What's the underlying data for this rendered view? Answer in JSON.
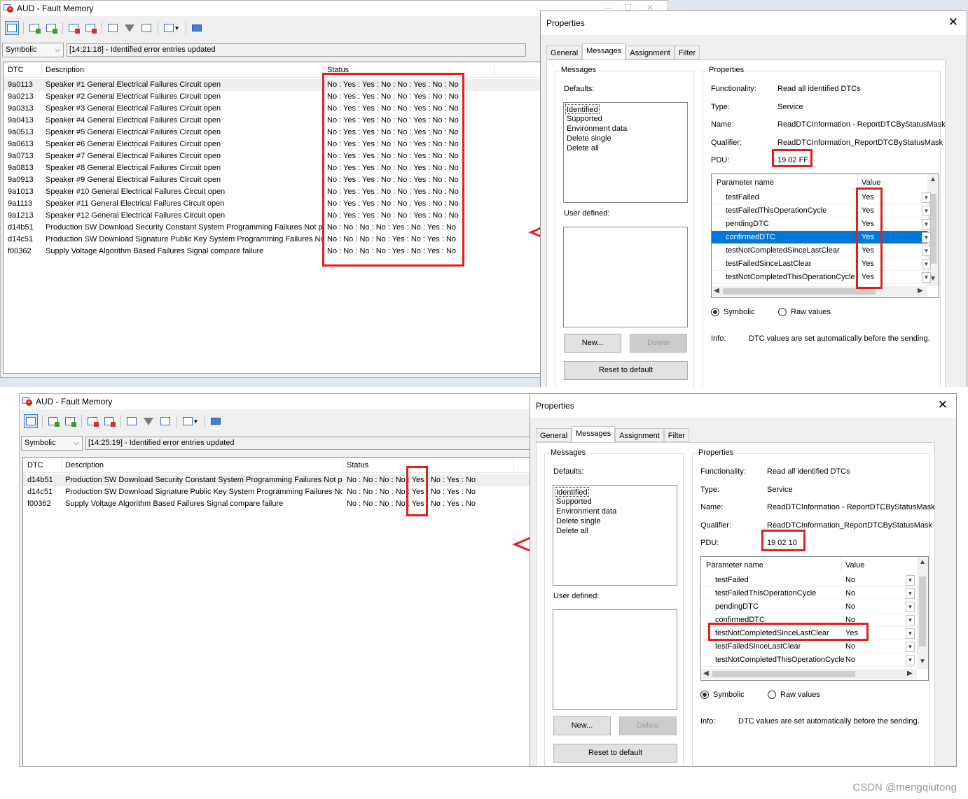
{
  "screens": [
    {
      "fault_memory": {
        "title": "AUD - Fault Memory",
        "mode": "Symbolic",
        "message": "[14:21:18] - Identified error entries updated",
        "columns": {
          "dtc": "DTC",
          "description": "Description",
          "status": "Status"
        },
        "rows": [
          {
            "dtc": "9a0113",
            "desc": "Speaker #1 General Electrical Failures Circuit open",
            "status": "No : Yes : Yes : No : No : Yes : No : No"
          },
          {
            "dtc": "9a0213",
            "desc": "Speaker #2 General Electrical Failures Circuit open",
            "status": "No : Yes : Yes : No : No : Yes : No : No"
          },
          {
            "dtc": "9a0313",
            "desc": "Speaker #3 General Electrical Failures Circuit open",
            "status": "No : Yes : Yes : No : No : Yes : No : No"
          },
          {
            "dtc": "9a0413",
            "desc": "Speaker #4 General Electrical Failures Circuit open",
            "status": "No : Yes : Yes : No : No : Yes : No : No"
          },
          {
            "dtc": "9a0513",
            "desc": "Speaker #5 General Electrical Failures Circuit open",
            "status": "No : Yes : Yes : No : No : Yes : No : No"
          },
          {
            "dtc": "9a0613",
            "desc": "Speaker #6 General Electrical Failures Circuit open",
            "status": "No : Yes : Yes : No : No : Yes : No : No"
          },
          {
            "dtc": "9a0713",
            "desc": "Speaker #7 General Electrical Failures Circuit open",
            "status": "No : Yes : Yes : No : No : Yes : No : No"
          },
          {
            "dtc": "9a0813",
            "desc": "Speaker #8 General Electrical Failures Circuit open",
            "status": "No : Yes : Yes : No : No : Yes : No : No"
          },
          {
            "dtc": "9a0913",
            "desc": "Speaker #9 General Electrical Failures Circuit open",
            "status": "No : Yes : Yes : No : No : Yes : No : No"
          },
          {
            "dtc": "9a1013",
            "desc": "Speaker #10 General Electrical Failures Circuit open",
            "status": "No : Yes : Yes : No : No : Yes : No : No"
          },
          {
            "dtc": "9a1113",
            "desc": "Speaker #11 General Electrical Failures Circuit open",
            "status": "No : Yes : Yes : No : No : Yes : No : No"
          },
          {
            "dtc": "9a1213",
            "desc": "Speaker #12 General Electrical Failures Circuit open",
            "status": "No : Yes : Yes : No : No : Yes : No : No"
          },
          {
            "dtc": "d14b51",
            "desc": "Production SW Download Security Constant System Programming Failures Not pr...",
            "status": "No : No : No : No : Yes : No : Yes : No"
          },
          {
            "dtc": "d14c51",
            "desc": "Production SW Download Signature Public Key System Programming Failures No...",
            "status": "No : No : No : No : Yes : No : Yes : No"
          },
          {
            "dtc": "f00362",
            "desc": "Supply Voltage Algorithm Based Failures Signal compare failure",
            "status": "No : No : No : No : Yes : No : Yes : No"
          }
        ]
      },
      "properties": {
        "title": "Properties",
        "tabs": [
          "General",
          "Messages",
          "Assignment",
          "Filter"
        ],
        "active_tab": "Messages",
        "messages_group": "Messages",
        "defaults_label": "Defaults:",
        "defaults": [
          "Identified",
          "Supported",
          "Environment data",
          "Delete single",
          "Delete all"
        ],
        "user_defined_label": "User defined:",
        "buttons": {
          "new": "New...",
          "delete": "Delete",
          "reset": "Reset to default"
        },
        "properties_group": "Properties",
        "fields": [
          {
            "label": "Functionality:",
            "value": "Read all identified DTCs"
          },
          {
            "label": "Type:",
            "value": "Service"
          },
          {
            "label": "Name:",
            "value": "ReadDTCInformation - ReportDTCByStatusMask"
          },
          {
            "label": "Qualifier:",
            "value": "ReadDTCInformation_ReportDTCByStatusMask"
          },
          {
            "label": "PDU:",
            "value": "19 02 FF"
          }
        ],
        "param_header": {
          "name": "Parameter name",
          "value": "Value"
        },
        "params": [
          {
            "name": "testFailed",
            "value": "Yes"
          },
          {
            "name": "testFailedThisOperationCycle",
            "value": "Yes"
          },
          {
            "name": "pendingDTC",
            "value": "Yes"
          },
          {
            "name": "confirmedDTC",
            "value": "Yes"
          },
          {
            "name": "testNotCompletedSinceLastClear",
            "value": "Yes"
          },
          {
            "name": "testFailedSinceLastClear",
            "value": "Yes"
          },
          {
            "name": "testNotCompletedThisOperationCycle",
            "value": "Yes"
          }
        ],
        "selected_param": 3,
        "radio_symbolic": "Symbolic",
        "radio_raw": "Raw values",
        "info_label": "Info:",
        "info_text": "DTC values are set automatically before the sending."
      }
    },
    {
      "fault_memory": {
        "title": "AUD - Fault Memory",
        "mode": "Symbolic",
        "message": "[14:25:19] - Identified error entries updated",
        "columns": {
          "dtc": "DTC",
          "description": "Description",
          "status": "Status"
        },
        "rows": [
          {
            "dtc": "d14b51",
            "desc": "Production SW Download Security Constant System Programming Failures Not pr...",
            "status": "No : No : No : No : Yes : No : Yes : No"
          },
          {
            "dtc": "d14c51",
            "desc": "Production SW Download Signature Public Key System Programming Failures No...",
            "status": "No : No : No : No : Yes : No : Yes : No"
          },
          {
            "dtc": "f00362",
            "desc": "Supply Voltage Algorithm Based Failures Signal compare failure",
            "status": "No : No : No : No : Yes : No : Yes : No"
          }
        ]
      },
      "properties": {
        "title": "Properties",
        "tabs": [
          "General",
          "Messages",
          "Assignment",
          "Filter"
        ],
        "active_tab": "Messages",
        "messages_group": "Messages",
        "defaults_label": "Defaults:",
        "defaults": [
          "Identified",
          "Supported",
          "Environment data",
          "Delete single",
          "Delete all"
        ],
        "user_defined_label": "User defined:",
        "buttons": {
          "new": "New...",
          "delete": "Delete",
          "reset": "Reset to default"
        },
        "properties_group": "Properties",
        "fields": [
          {
            "label": "Functionality:",
            "value": "Read all identified DTCs"
          },
          {
            "label": "Type:",
            "value": "Service"
          },
          {
            "label": "Name:",
            "value": "ReadDTCInformation - ReportDTCByStatusMask"
          },
          {
            "label": "Qualifier:",
            "value": "ReadDTCInformation_ReportDTCByStatusMask"
          },
          {
            "label": "PDU:",
            "value": "19 02 10"
          }
        ],
        "param_header": {
          "name": "Parameter name",
          "value": "Value"
        },
        "params": [
          {
            "name": "testFailed",
            "value": "No"
          },
          {
            "name": "testFailedThisOperationCycle",
            "value": "No"
          },
          {
            "name": "pendingDTC",
            "value": "No"
          },
          {
            "name": "confirmedDTC",
            "value": "No"
          },
          {
            "name": "testNotCompletedSinceLastClear",
            "value": "Yes"
          },
          {
            "name": "testFailedSinceLastClear",
            "value": "No"
          },
          {
            "name": "testNotCompletedThisOperationCycle",
            "value": "No"
          }
        ],
        "selected_param": -1,
        "radio_symbolic": "Symbolic",
        "radio_raw": "Raw values",
        "info_label": "Info:",
        "info_text": "DTC values are set automatically before the sending."
      }
    }
  ],
  "watermark": "CSDN @mengqiutong",
  "colors": {
    "highlight": "#e02020",
    "selection": "#0078d7"
  }
}
